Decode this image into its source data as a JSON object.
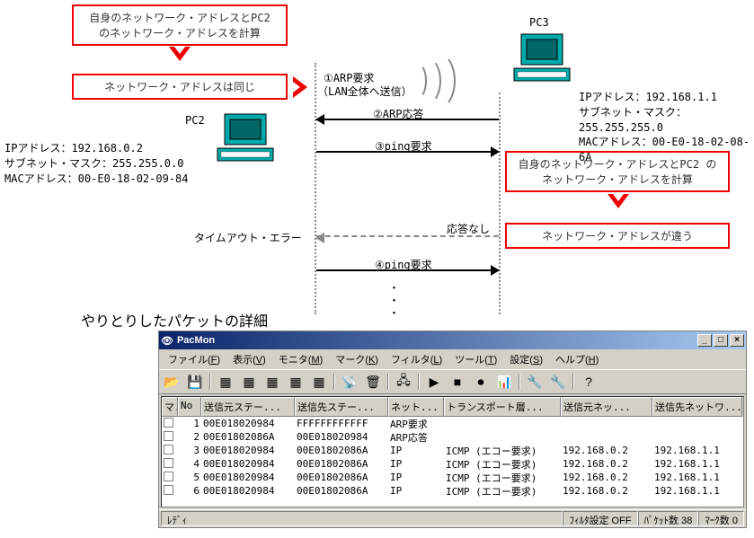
{
  "diagram": {
    "box1": "自身のネットワーク・アドレスとPC2\nのネットワーク・アドレスを計算",
    "box2": "ネットワーク・アドレスは同じ",
    "box3": "自身のネットワーク・アドレスとPC2\nのネットワーク・アドレスを計算",
    "box4": "ネットワーク・アドレスが違う",
    "pc2_label": "PC2",
    "pc3_label": "PC3",
    "pc2_info": {
      "ip_label": "IPアドレス：192.168.0.2",
      "mask_label": "サブネット・マスク：255.255.0.0",
      "mac_label": "MACアドレス：00-E0-18-02-09-84"
    },
    "pc3_info": {
      "ip_label": "IPアドレス：192.168.1.1",
      "mask_label": "サブネット・マスク：255.255.255.0",
      "mac_label": "MACアドレス：00-E0-18-02-08-6A"
    },
    "arrow_arp_req1": "①ARP要求",
    "arrow_arp_req2": "（LAN全体へ送信）",
    "arrow_arp_res": "②ARP応答",
    "arrow_ping_req": "③ping要求",
    "arrow_no_res": "応答なし",
    "arrow_timeout": "タイムアウト・エラー",
    "arrow_ping_req2": "④ping要求",
    "dots": "・・・",
    "section_title": "やりとりしたパケットの詳細"
  },
  "pacmon": {
    "title": "PacMon",
    "menus": [
      {
        "label": "ファイル",
        "key": "F"
      },
      {
        "label": "表示",
        "key": "V"
      },
      {
        "label": "モニタ",
        "key": "M"
      },
      {
        "label": "マーク",
        "key": "K"
      },
      {
        "label": "フィルタ",
        "key": "L"
      },
      {
        "label": "ツール",
        "key": "T"
      },
      {
        "label": "設定",
        "key": "S"
      },
      {
        "label": "ヘルプ",
        "key": "H"
      }
    ],
    "toolbar_icons": [
      "file-open-icon",
      "save-icon",
      "grid1-icon",
      "grid2-icon",
      "grid3-icon",
      "grid4-icon",
      "grid5-icon",
      "antenna-icon",
      "filter-icon",
      "nic-icon",
      "play-icon",
      "stop-icon",
      "record-icon",
      "bars-icon",
      "tool1-icon",
      "tool2-icon",
      "help-icon"
    ],
    "columns": [
      "マ.",
      "No",
      "送信元ステー...",
      "送信先ステー...",
      "ネット...",
      "トランスポート層...",
      "送信元ネッ...",
      "送信先ネットワ..."
    ],
    "rows": [
      {
        "no": "1",
        "src": "00E018020984",
        "dst": "FFFFFFFFFFFF",
        "net": "ARP要求",
        "tr": "",
        "sip": "",
        "dip": ""
      },
      {
        "no": "2",
        "src": "00E01802086A",
        "dst": "00E018020984",
        "net": "ARP応答",
        "tr": "",
        "sip": "",
        "dip": ""
      },
      {
        "no": "3",
        "src": "00E018020984",
        "dst": "00E01802086A",
        "net": "IP",
        "tr": "ICMP (エコー要求)",
        "sip": "192.168.0.2",
        "dip": "192.168.1.1"
      },
      {
        "no": "4",
        "src": "00E018020984",
        "dst": "00E01802086A",
        "net": "IP",
        "tr": "ICMP (エコー要求)",
        "sip": "192.168.0.2",
        "dip": "192.168.1.1"
      },
      {
        "no": "5",
        "src": "00E018020984",
        "dst": "00E01802086A",
        "net": "IP",
        "tr": "ICMP (エコー要求)",
        "sip": "192.168.0.2",
        "dip": "192.168.1.1"
      },
      {
        "no": "6",
        "src": "00E018020984",
        "dst": "00E01802086A",
        "net": "IP",
        "tr": "ICMP (エコー要求)",
        "sip": "192.168.0.2",
        "dip": "192.168.1.1"
      }
    ],
    "status": {
      "ready": "ﾚﾃﾞｨ",
      "filter": "ﾌｨﾙﾀ設定 OFF",
      "packets": "ﾊﾟｹｯﾄ数 38",
      "marks": "ﾏｰｸ数 0"
    }
  }
}
